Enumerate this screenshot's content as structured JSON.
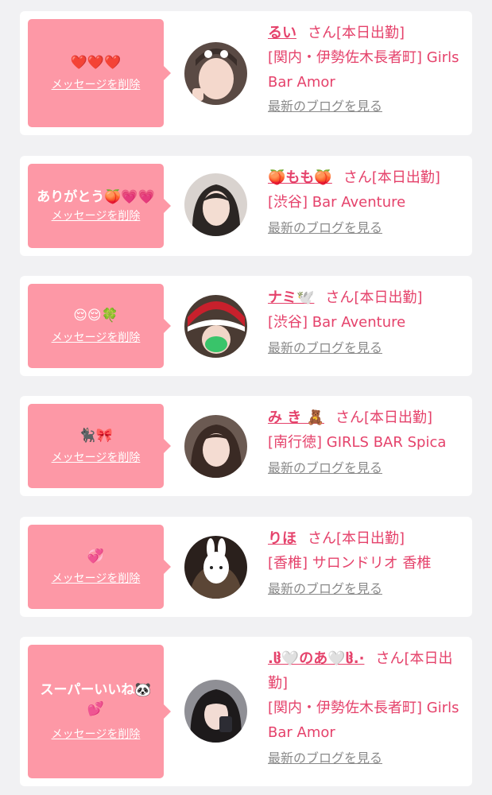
{
  "delete_label": "メッセージを削除",
  "san_label": "さん",
  "blog_label": "最新のブログを見る",
  "colors": {
    "bubble": "#fd98a6",
    "accent": "#e5426b",
    "card": "#ffffff",
    "background": "#f1f1f3",
    "link_gray": "#8a8a8a"
  },
  "cards": [
    {
      "message": "❤️❤️❤️",
      "name": "るい",
      "status": "[本日出勤]",
      "shop": "[関内・伊勢佐木長者町] Girls Bar Amor"
    },
    {
      "message": "ありがとう🍑💗💗",
      "name": "🍑もも🍑",
      "status": "[本日出勤]",
      "shop": "[渋谷] Bar Aventure"
    },
    {
      "message": "😌😌🍀",
      "name": "ナミ🕊️",
      "status": "[本日出勤]",
      "shop": "[渋谷] Bar Aventure"
    },
    {
      "message": "🐈‍⬛🎀",
      "name": "み き 🧸",
      "status": "[本日出勤]",
      "shop": "[南行徳] GIRLS BAR Spica"
    },
    {
      "message": "💞",
      "name": "りほ",
      "status": "[本日出勤]",
      "shop": "[香椎] サロンドリオ 香椎"
    },
    {
      "message": "スーパーいいね🐼💕",
      "name": ".ჱ̒🤍のあ🤍ჱ̒.·",
      "status": "[本日出勤]",
      "shop": "[関内・伊勢佐木長者町] Girls Bar Amor"
    }
  ]
}
